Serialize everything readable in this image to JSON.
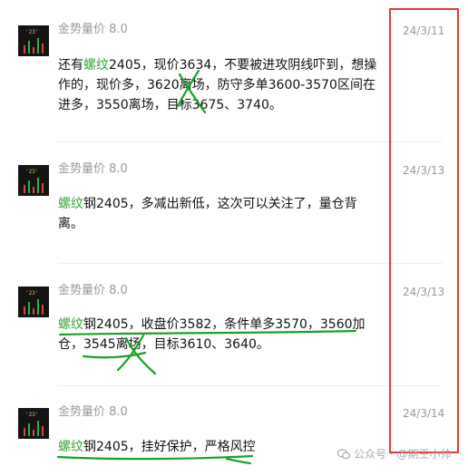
{
  "messages": [
    {
      "sender": "金势量价 8.0",
      "date": "24/3/11",
      "avatar_tag": "'23'",
      "text_prefix": "还有",
      "keyword": "螺纹",
      "text_rest": "2405，现价3634，不要被进攻阴线吓到，想操作的，现价多，3620离场，防守多单3600-3570区间在进多，3550离场，目标3675、3740。"
    },
    {
      "sender": "金势量价 8.0",
      "date": "24/3/13",
      "avatar_tag": "'23'",
      "text_prefix": "",
      "keyword": "螺纹",
      "text_rest": "钢2405，多减出新低，这次可以关注了，量仓背离。"
    },
    {
      "sender": "金势量价 8.0",
      "date": "24/3/13",
      "avatar_tag": "'23'",
      "text_prefix": "",
      "keyword": "螺纹",
      "text_rest": "钢2405，收盘价3582，条件单多3570，3560加仓，3545离场，目标3610、3640。"
    },
    {
      "sender": "金势量价 8.0",
      "date": "24/3/14",
      "avatar_tag": "'23'",
      "text_prefix": "",
      "keyword": "螺纹",
      "text_rest": "钢2405，挂好保护，严格风控"
    }
  ],
  "watermark": "公众号 · @期王小帅",
  "colors": {
    "keyword": "#3aa63a",
    "annotation_green": "#1aa12a",
    "highlight_box": "#e53935",
    "meta_text": "#9a9a9a"
  },
  "icons": {
    "watermark": "wechat-official-account-icon"
  }
}
